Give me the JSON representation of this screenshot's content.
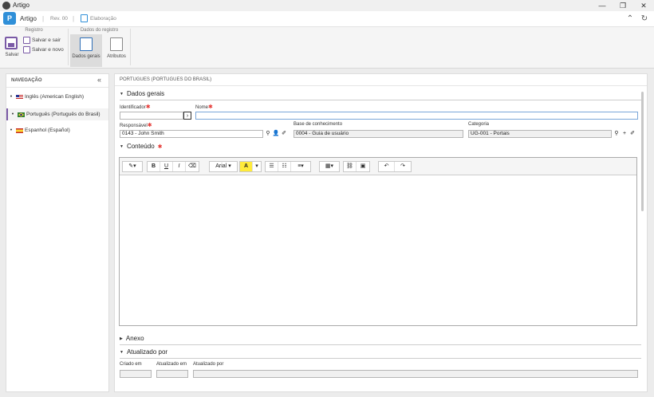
{
  "window": {
    "title": "Artigo"
  },
  "header": {
    "app_name": "Artigo",
    "rev": "Rev. 00",
    "stage": "Elaboração"
  },
  "ribbon": {
    "group_registro": "Registro",
    "group_dados": "Dados do registro",
    "save": "Salvar",
    "save_exit": "Salvar e sair",
    "save_new": "Salvar e novo",
    "general_data": "Dados gerais",
    "attributes": "Atributos"
  },
  "nav": {
    "title": "NAVEGAÇÃO",
    "items": [
      {
        "label": "Inglês (American English)"
      },
      {
        "label": "Português (Português do Brasil)"
      },
      {
        "label": "Espanhol (Español)"
      }
    ]
  },
  "main": {
    "breadcrumb": "PORTUGUES (PORTUGUES DO BRASIL)",
    "section_general": "Dados gerais",
    "label_id": "Identificador",
    "label_name": "Nome",
    "label_responsible": "Responsável",
    "value_responsible": "0143 - John Smith",
    "label_kb": "Base de conhecimento",
    "value_kb": "0004 - Guia de usuário",
    "label_category": "Categoria",
    "value_category": "UG-001 - Portais",
    "section_content": "Conteúdo",
    "editor_font": "Arial",
    "section_attachment": "Anexo",
    "section_updated": "Atualizado por",
    "label_created": "Criado em",
    "label_updated_on": "Atualizado em",
    "label_updated_by": "Atualizado por"
  },
  "colors": {
    "accent": "#7a5aa6",
    "brand": "#2f8fd8",
    "required": "#e53935"
  }
}
